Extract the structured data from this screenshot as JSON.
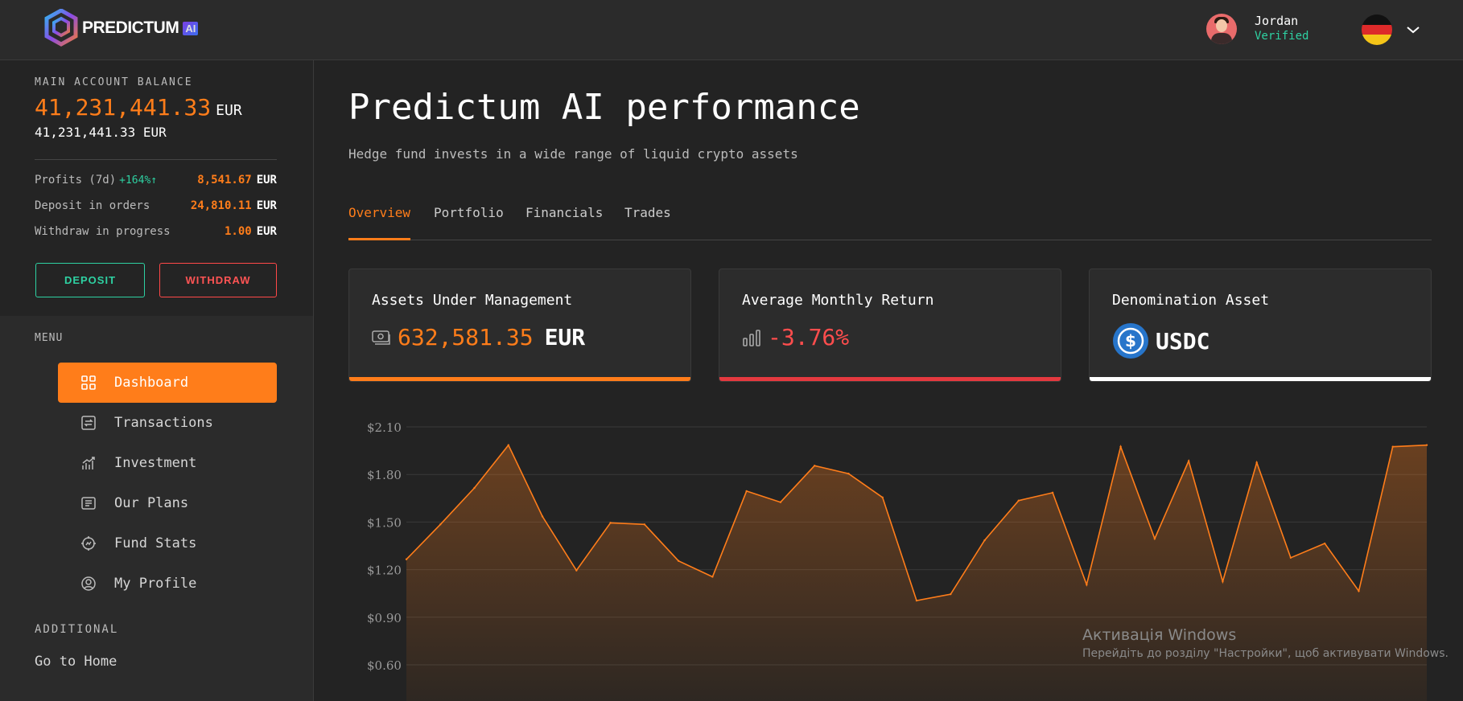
{
  "brand": {
    "name": "PREDICTUM",
    "badge": "AI"
  },
  "user": {
    "name": "Jordan",
    "status": "Verified"
  },
  "sidebar": {
    "balance_label": "MAIN ACCOUNT BALANCE",
    "balance_main": "41,231,441.33",
    "balance_currency": "EUR",
    "balance_sub": "41,231,441.33 EUR",
    "stats": [
      {
        "label": "Profits (7d)",
        "pct": "+164%↑",
        "value": "8,541.67",
        "currency": "EUR"
      },
      {
        "label": "Deposit in orders",
        "value": "24,810.11",
        "currency": "EUR"
      },
      {
        "label": "Withdraw in progress",
        "value": "1.00",
        "currency": "EUR"
      }
    ],
    "deposit_label": "DEPOSIT",
    "withdraw_label": "WITHDRAW",
    "menu_label": "MENU",
    "menu": [
      {
        "label": "Dashboard",
        "icon": "grid-icon"
      },
      {
        "label": "Transactions",
        "icon": "transactions-icon"
      },
      {
        "label": "Investment",
        "icon": "chart-up-icon"
      },
      {
        "label": "Our Plans",
        "icon": "plans-icon"
      },
      {
        "label": "Fund Stats",
        "icon": "gear-chart-icon"
      },
      {
        "label": "My Profile",
        "icon": "profile-icon"
      }
    ],
    "additional_label": "ADDITIONAL",
    "home_link": "Go to Home"
  },
  "main": {
    "title": "Predictum AI performance",
    "subtitle": "Hedge fund invests in a wide range of liquid crypto assets",
    "tabs": [
      "Overview",
      "Portfolio",
      "Financials",
      "Trades"
    ],
    "cards": [
      {
        "title": "Assets Under Management",
        "value": "632,581.35",
        "unit": "EUR",
        "accent": "#ff7d1a"
      },
      {
        "title": "Average Monthly Return",
        "value": "-3.76%",
        "accent": "#e5393f"
      },
      {
        "title": "Denomination Asset",
        "value": "USDC",
        "accent": "#ffffff"
      }
    ]
  },
  "chart_data": {
    "type": "area",
    "ytick_labels": [
      "$2.10",
      "$1.80",
      "$1.50",
      "$1.20",
      "$0.90",
      "$0.60"
    ],
    "yticks": [
      2.1,
      1.8,
      1.5,
      1.2,
      0.9,
      0.6
    ],
    "ylim": [
      0.6,
      2.1
    ],
    "color": "#ff7d1a",
    "grid": true,
    "values": [
      1.26,
      1.48,
      1.71,
      1.98,
      1.53,
      1.19,
      1.49,
      1.48,
      1.25,
      1.15,
      1.69,
      1.62,
      1.85,
      1.8,
      1.65,
      1.0,
      1.04,
      1.38,
      1.63,
      1.68,
      1.1,
      1.97,
      1.39,
      1.88,
      1.12,
      1.87,
      1.27,
      1.36,
      1.06,
      1.97,
      1.98
    ]
  },
  "watermark": {
    "line1": "Активація Windows",
    "line2": "Перейдіть до розділу \"Настройки\", щоб активувати Windows."
  }
}
